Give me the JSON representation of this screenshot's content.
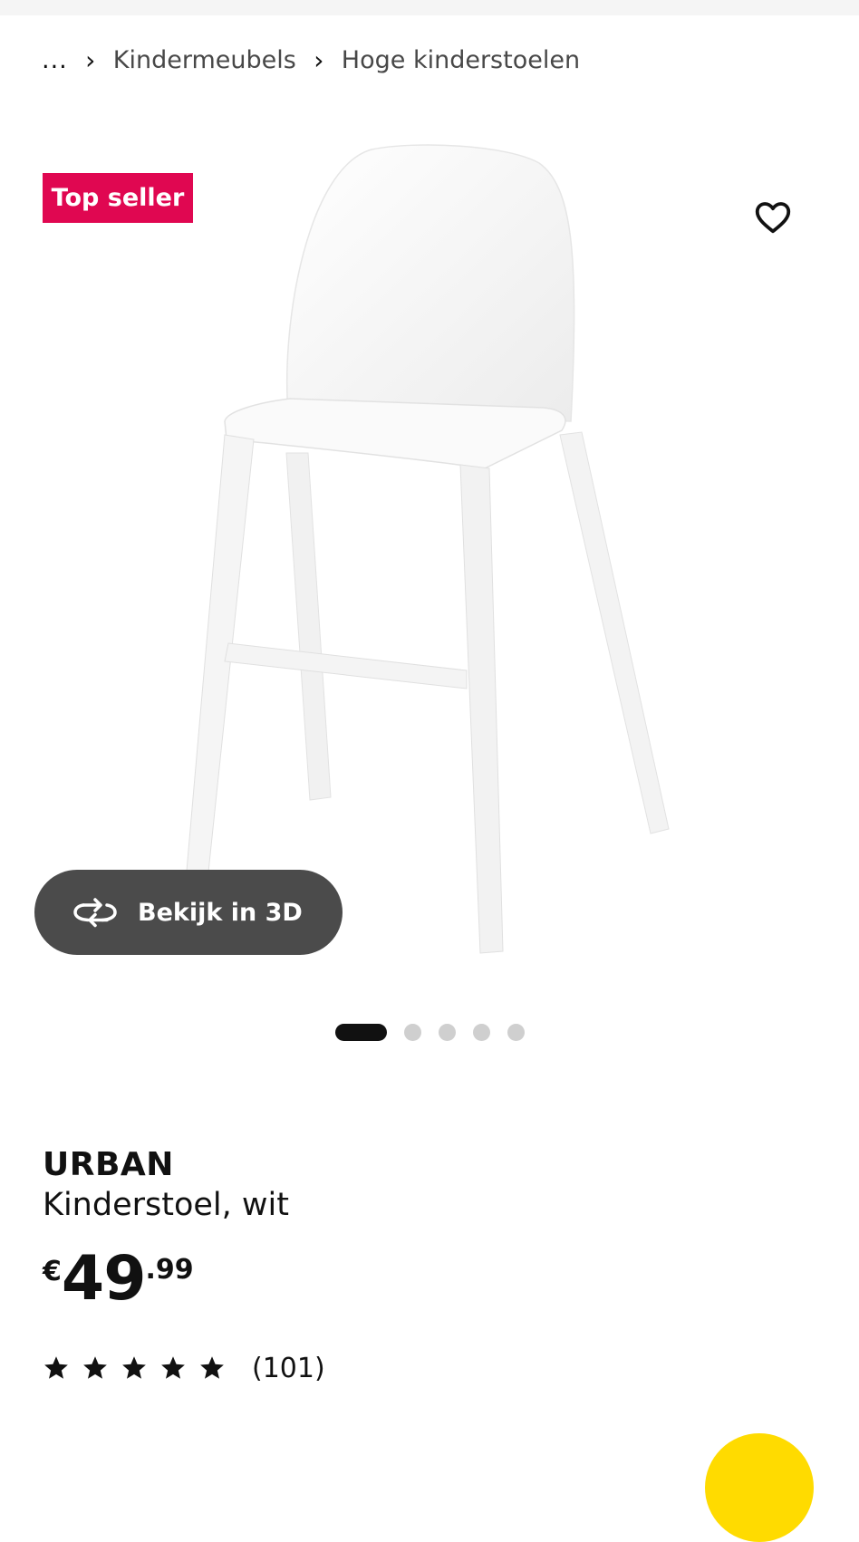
{
  "breadcrumb": {
    "ellipsis": "...",
    "separator": "›",
    "items": [
      "Kindermeubels",
      "Hoge kinderstoelen"
    ]
  },
  "gallery": {
    "badge": "Top seller",
    "view3d_label": "Bekijk in 3D",
    "view3d_icon": "rotate-3d-icon",
    "favorite_icon": "heart-icon",
    "image_count": 5,
    "active_image": 1
  },
  "product": {
    "name": "URBAN",
    "description": "Kinderstoel, wit",
    "price": {
      "currency": "€",
      "integer": "49",
      "decimal": ".99"
    },
    "rating": {
      "stars": 5,
      "count": "(101)"
    }
  },
  "colors": {
    "badge": "#e00751",
    "view3d_bg": "#4b4b4b",
    "accent_yellow": "#ffdb00"
  }
}
